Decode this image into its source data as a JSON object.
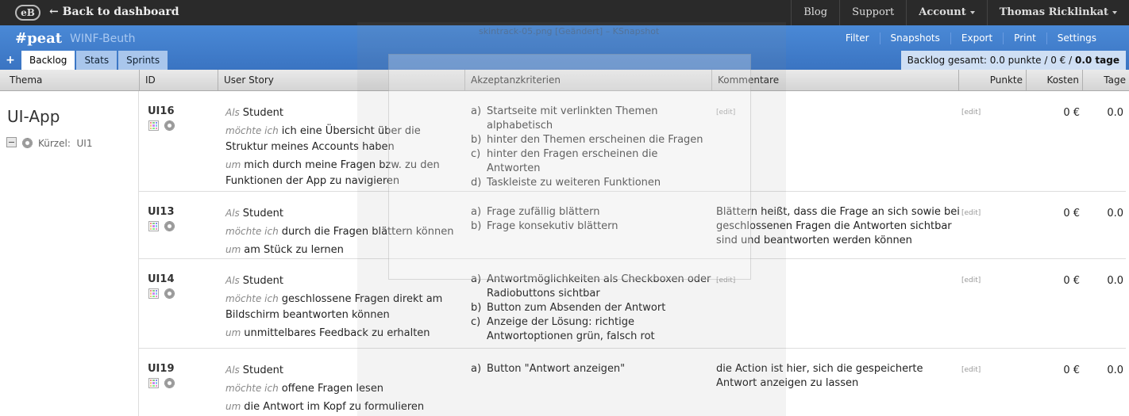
{
  "topbar": {
    "logo": "eB",
    "back": "← Back to dashboard",
    "nav": [
      {
        "label": "Blog",
        "bold": false,
        "caret": false
      },
      {
        "label": "Support",
        "bold": false,
        "caret": false
      },
      {
        "label": "Account",
        "bold": true,
        "caret": true
      },
      {
        "label": "Thomas Ricklinkat",
        "bold": true,
        "caret": true
      }
    ]
  },
  "project": {
    "name": "#peat",
    "sub": "WINF-Beuth"
  },
  "menu": [
    "Filter",
    "Snapshots",
    "Export",
    "Print",
    "Settings"
  ],
  "add_icon": "+",
  "tabs": [
    {
      "label": "Backlog",
      "active": true
    },
    {
      "label": "Stats",
      "active": false
    },
    {
      "label": "Sprints",
      "active": false
    }
  ],
  "total": {
    "label": "Backlog gesamt:",
    "value": "0.0 punkte / 0 € /",
    "days": "0.0 tage"
  },
  "columns": {
    "thema": "Thema",
    "id": "ID",
    "story": "User Story",
    "criteria": "Akzeptanzkriterien",
    "comments": "Kommentare",
    "points": "Punkte",
    "cost": "Kosten",
    "days": "Tage"
  },
  "theme": {
    "name": "UI-App",
    "short_label": "Kürzel:",
    "short_value": "UI1"
  },
  "keywords": {
    "als": "Als",
    "moechte": "möchte ich",
    "um": "um"
  },
  "edit_label": "[edit]",
  "rows": [
    {
      "id": "UI16",
      "role": "Student",
      "want": "ich eine Übersicht über die Struktur meines Accounts haben",
      "goal": "mich durch meine Fragen bzw. zu den Funktionen der App zu navigieren",
      "criteria": [
        {
          "label": "a)",
          "text": "Startseite mit verlinkten Themen alphabetisch"
        },
        {
          "label": "b)",
          "text": "hinter den Themen erscheinen die Fragen"
        },
        {
          "label": "c)",
          "text": "hinter den Fragen erscheinen die Antworten"
        },
        {
          "label": "d)",
          "text": "Taskleiste zu weiteren Funktionen"
        }
      ],
      "comment": "",
      "cost": "0 €",
      "days": "0.0"
    },
    {
      "id": "UI13",
      "role": "Student",
      "want": "durch die Fragen blättern können",
      "goal": "am Stück zu lernen",
      "criteria": [
        {
          "label": "a)",
          "text": "Frage zufällig blättern"
        },
        {
          "label": "b)",
          "text": "Frage konsekutiv blättern"
        }
      ],
      "comment": "Blättern heißt, dass die Frage an sich sowie bei geschlossenen Fragen die Antworten sichtbar sind und beantworten werden können",
      "cost": "0 €",
      "days": "0.0"
    },
    {
      "id": "UI14",
      "role": "Student",
      "want": "geschlossene Fragen direkt am Bildschirm beantworten können",
      "goal": "unmittelbares Feedback zu erhalten",
      "criteria": [
        {
          "label": "a)",
          "text": "Antwortmöglichkeiten als Checkboxen oder Radiobuttons sichtbar"
        },
        {
          "label": "b)",
          "text": "Button zum Absenden der Antwort"
        },
        {
          "label": "c)",
          "text": "Anzeige der Lösung: richtige Antwortoptionen grün, falsch rot"
        }
      ],
      "comment": "",
      "cost": "0 €",
      "days": "0.0"
    },
    {
      "id": "UI19",
      "role": "Student",
      "want": "offene Fragen lesen",
      "goal": "die Antwort im Kopf zu formulieren",
      "criteria": [
        {
          "label": "a)",
          "text": "Button \"Antwort anzeigen\""
        }
      ],
      "comment": "die Action ist hier, sich die gespeicherte Antwort anzeigen zu lassen",
      "cost": "0 €",
      "days": "0.0"
    }
  ],
  "overlay": {
    "title": "skintrack-05.png [Geändert] – KSnapshot"
  },
  "colors": {
    "topbar": "#2a2a2a",
    "bluebar": "#4a89d6",
    "tab_inactive": "#a9c6ec",
    "total_bg": "#cfdff4"
  }
}
